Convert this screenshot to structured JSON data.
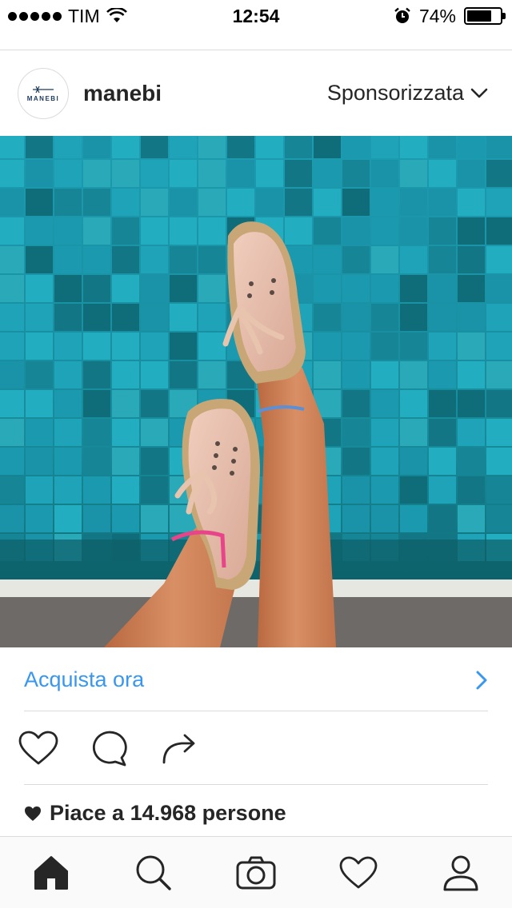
{
  "status_bar": {
    "carrier": "TIM",
    "time": "12:54",
    "battery_percent_text": "74%",
    "battery_level": 0.74,
    "icons": [
      "signal-dots",
      "wifi-icon",
      "alarm-icon",
      "battery-icon"
    ]
  },
  "post": {
    "account": {
      "username": "manebi",
      "avatar_logo_text": "MANEBI"
    },
    "sponsored_label": "Sponsorizzata",
    "photo": {
      "subject": "pink espadrille sneakers over turquoise pool tiles"
    },
    "cta": {
      "label": "Acquista ora"
    },
    "actions": [
      "heart-icon",
      "comment-icon",
      "share-icon"
    ],
    "likes_text": "Piace a 14.968 persone"
  },
  "tab_bar": {
    "items": [
      "home-icon",
      "search-icon",
      "camera-icon",
      "activity-heart-icon",
      "profile-icon"
    ]
  },
  "colors": {
    "link_blue": "#3897f0",
    "text": "#262626",
    "divider": "#dbdbdb",
    "pool_teal": "#1a8ea3"
  }
}
